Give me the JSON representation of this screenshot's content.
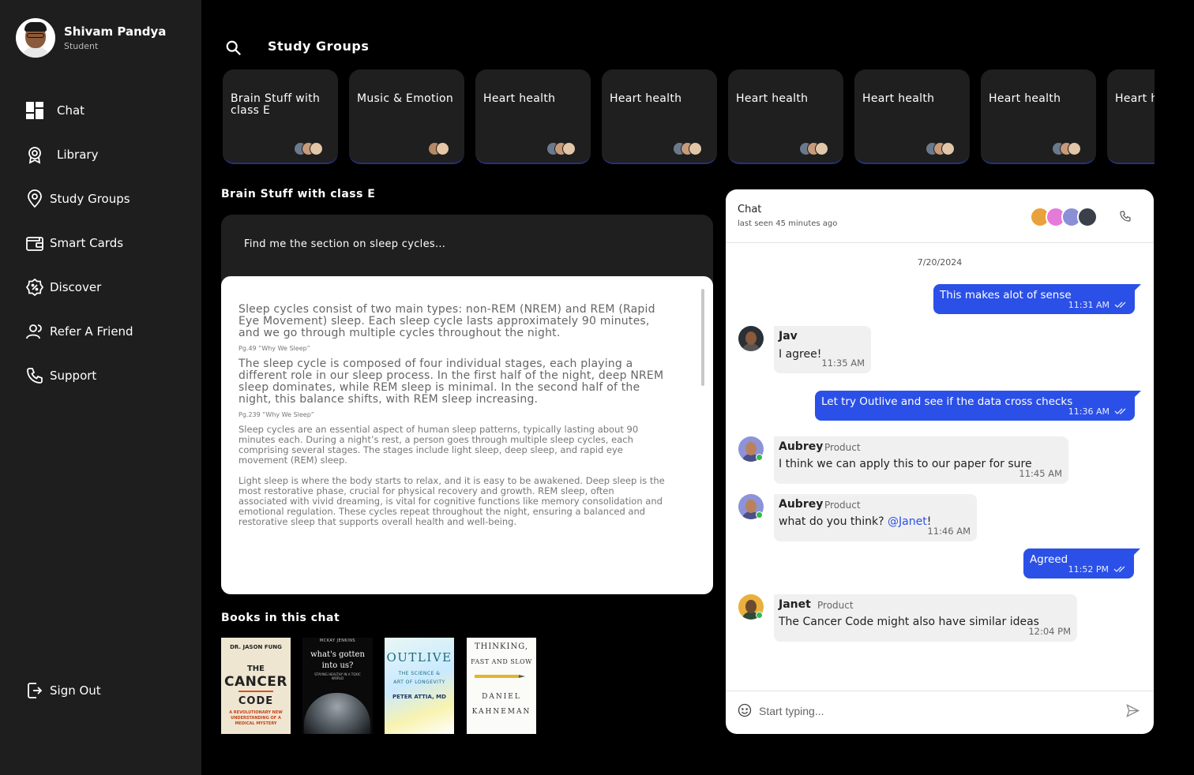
{
  "user": {
    "name": "Shivam Pandya",
    "role": "Student"
  },
  "nav": {
    "items": [
      {
        "label": "Chat",
        "icon": "dashboard-icon"
      },
      {
        "label": "Library",
        "icon": "badge-icon"
      },
      {
        "label": "Study Groups",
        "icon": "location-pin-icon"
      },
      {
        "label": "Smart Cards",
        "icon": "wallet-icon"
      },
      {
        "label": "Discover",
        "icon": "discount-badge-icon"
      },
      {
        "label": "Refer A Friend",
        "icon": "user-icon"
      },
      {
        "label": "Support",
        "icon": "phone-icon"
      }
    ],
    "sign_out": "Sign Out"
  },
  "header": {
    "title": "Study Groups"
  },
  "groups": [
    {
      "name": "Brain Stuff with class E"
    },
    {
      "name": "Music & Emotion"
    },
    {
      "name": "Heart health"
    },
    {
      "name": "Heart health"
    },
    {
      "name": "Heart health"
    },
    {
      "name": "Heart health"
    },
    {
      "name": "Heart health"
    },
    {
      "name": "Heart health"
    }
  ],
  "section": {
    "title": "Brain Stuff with class E",
    "query": "Find me the section on sleep cycles...",
    "result": {
      "p1": "Sleep cycles consist of two main types: non-REM (NREM) and REM (Rapid Eye Movement) sleep. Each sleep cycle lasts approximately 90 minutes, and we go through multiple cycles throughout the night.",
      "c1": "Pg.49 “Why We Sleep”",
      "p2": "The sleep cycle is composed of four individual stages, each playing a different role in our sleep process. In the first half of the night, deep NREM sleep dominates, while REM sleep is minimal. In the second half of the night, this balance shifts, with REM sleep increasing.",
      "c2": "Pg.239 “Why We Sleep”",
      "p3": "Sleep cycles are an essential aspect of human sleep patterns, typically lasting about 90 minutes each. During a night’s rest, a person goes through multiple sleep cycles, each comprising several stages. The stages include light sleep, deep sleep, and rapid eye movement (REM) sleep.",
      "p4": "Light sleep is where the body starts to relax, and it is easy to be awakened. Deep sleep is the most restorative phase, crucial for physical recovery and growth. REM sleep, often associated with vivid dreaming, is vital for cognitive functions like memory consolidation and emotional regulation. These cycles repeat throughout the night, ensuring a balanced and restorative sleep that supports overall health and well-being."
    }
  },
  "books": {
    "title": "Books in this chat",
    "items": [
      {
        "author": "DR. JASON FUNG",
        "title_lines": [
          "THE",
          "CANCER",
          "CODE"
        ],
        "sub": "A REVOLUTIONARY NEW UNDERSTANDING OF A MEDICAL MYSTERY"
      },
      {
        "author": "MCKAY JENKINS",
        "title_lines": [
          "what's gotten",
          "into us?"
        ],
        "sub": "STAYING HEALTHY IN A TOXIC WORLD"
      },
      {
        "author": "PETER ATTIA, MD",
        "title_lines": [
          "OUTLIVE"
        ],
        "sub": "THE SCIENCE & ART OF LONGEVITY"
      },
      {
        "author": "DANIEL KAHNEMAN",
        "title_lines": [
          "THINKING,",
          "FAST AND SLOW"
        ],
        "sub": ""
      }
    ]
  },
  "chat": {
    "title": "Chat",
    "last_seen": "last seen 45 minutes ago",
    "date": "7/20/2024",
    "input_placeholder": "Start typing...",
    "messages": [
      {
        "text": "This makes alot of sense",
        "time": "11:31 AM"
      },
      {
        "name": "Jav",
        "text": "I agree!",
        "time": "11:35 AM"
      },
      {
        "text": "Let try Outlive and see if the data cross checks",
        "time": "11:36 AM"
      },
      {
        "name": "Aubrey",
        "role": "Product",
        "text": "I think we can apply this to our paper for sure",
        "time": "11:45 AM"
      },
      {
        "name": "Aubrey",
        "role": "Product",
        "text": "what do you think? ",
        "mention": "@Janet",
        "suffix": "!",
        "time": "11:46 AM"
      },
      {
        "text": "Agreed",
        "time": "11:52 PM"
      },
      {
        "name": "Janet",
        "role": "Product",
        "text": "The Cancer Code might also have similar ideas",
        "time": "12:04 PM"
      }
    ]
  },
  "colors": {
    "accent": "#2b50e8",
    "sidebar": "#1e1e1e",
    "card": "#1f1f1f"
  }
}
